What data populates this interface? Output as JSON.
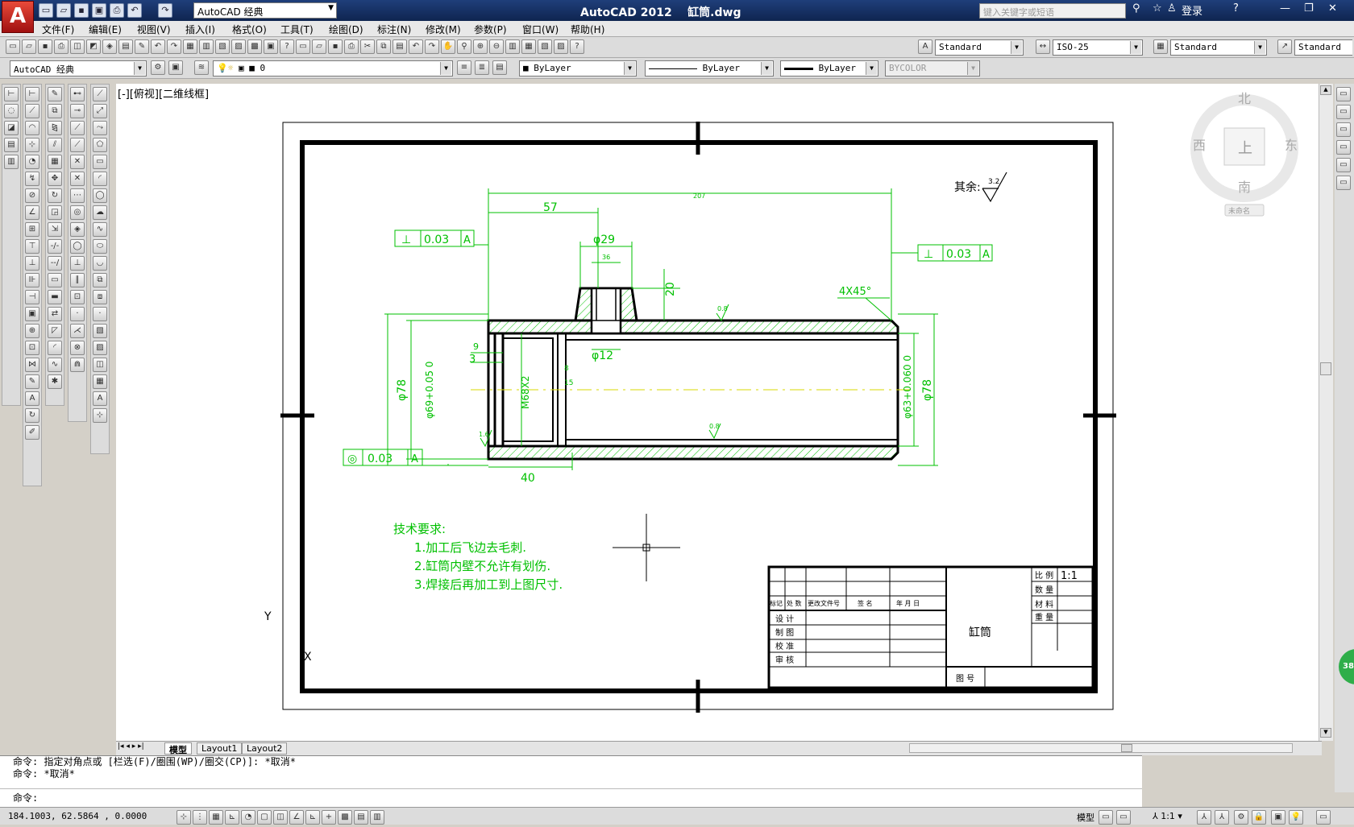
{
  "title_bar": {
    "workspace": "AutoCAD 经典",
    "app_title": "AutoCAD 2012",
    "file_name": "缸筒.dwg",
    "search_placeholder": "键入关键字或短语",
    "login": "登录"
  },
  "menus": [
    "文件(F)",
    "编辑(E)",
    "视图(V)",
    "插入(I)",
    "格式(O)",
    "工具(T)",
    "绘图(D)",
    "标注(N)",
    "修改(M)",
    "参数(P)",
    "窗口(W)",
    "帮助(H)"
  ],
  "styles_toolbar": {
    "text_style": "Standard",
    "dim_style": "ISO-25",
    "table_style": "Standard",
    "mleader_style": "Standard"
  },
  "layers_toolbar": {
    "workspace": "AutoCAD 经典",
    "layer": "0",
    "color": "ByLayer",
    "linetype": "ByLayer",
    "lineweight": "ByLayer",
    "plotstyle": "BYCOLOR"
  },
  "viewport_label": "[-][俯视][二维线框]",
  "viewcube": {
    "north": "北",
    "south": "南",
    "east": "东",
    "west": "西",
    "top": "上",
    "ucs": "未命名"
  },
  "drawing": {
    "surface_finish_label": "其余:",
    "surface_finish_value": "3.2",
    "dims": {
      "overall": "207",
      "d57": "57",
      "d29": "φ29",
      "d36": "36",
      "d20": "20",
      "chamfer": "4X45°",
      "d12": "φ12",
      "d40": "40",
      "d78_left": "φ78",
      "d69": "φ69+0.05 0",
      "m68": "M68X2",
      "d63": "φ63+0.060 0",
      "d78_right": "φ78",
      "d9": "9",
      "d3": "3",
      "d8": "8",
      "d15": "15"
    },
    "roughness": {
      "top": "0.8",
      "inner": "0.8",
      "left": "1.6"
    },
    "tolerances": {
      "left_perp": {
        "symbol": "⊥",
        "value": "0.03",
        "datum": "A"
      },
      "right_perp": {
        "symbol": "⊥",
        "value": "0.03",
        "datum": "A"
      },
      "concentric": {
        "symbol": "◎",
        "value": "0.03",
        "datum": "A"
      }
    },
    "tech_title": "技术要求:",
    "tech_items": [
      "1.加工后飞边去毛刺.",
      "2.缸筒内壁不允许有划伤.",
      "3.焊接后再加工到上图尺寸."
    ]
  },
  "title_block": {
    "scale_label": "比 例",
    "scale_value": "1:1",
    "qty_label": "数 量",
    "material_label": "材 料",
    "weight_label": "重 量",
    "part_name": "缸筒",
    "drawing_no_label": "图 号",
    "rows": {
      "mark": "标记",
      "count": "处 数",
      "change_doc": "更改文件号",
      "sign": "签 名",
      "date": "年 月 日",
      "design": "设 计",
      "draft": "制 图",
      "check": "校 准",
      "review": "审 核"
    }
  },
  "ucs": {
    "x": "X",
    "y": "Y"
  },
  "layout_tabs": [
    "模型",
    "Layout1",
    "Layout2"
  ],
  "command_lines": [
    "命令: 指定对角点或 [栏选(F)/圈围(WP)/圈交(CP)]: *取消*",
    "命令: *取消*",
    "命令:"
  ],
  "status": {
    "coords": "184.1003, 62.5864 , 0.0000",
    "model": "模型",
    "scale": "1:1",
    "badge": "38"
  }
}
